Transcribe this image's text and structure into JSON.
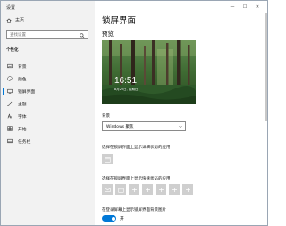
{
  "window": {
    "title": "设置"
  },
  "sidebar": {
    "home_label": "主页",
    "search_placeholder": "查找设置",
    "section_title": "个性化",
    "items": [
      {
        "label": "背景",
        "icon": "image-icon"
      },
      {
        "label": "颜色",
        "icon": "palette-icon"
      },
      {
        "label": "锁屏界面",
        "icon": "lock-screen-icon",
        "active": true
      },
      {
        "label": "主题",
        "icon": "brush-icon"
      },
      {
        "label": "字体",
        "icon": "font-icon"
      },
      {
        "label": "开始",
        "icon": "start-icon"
      },
      {
        "label": "任务栏",
        "icon": "taskbar-icon"
      }
    ]
  },
  "controls": {
    "minimize": "—",
    "maximize": "☐",
    "close": "✕"
  },
  "main": {
    "page_title": "锁屏界面",
    "preview_heading": "预览",
    "preview_time": "16:51",
    "preview_date": "8月22日, 星期日",
    "background_label": "背景",
    "background_value": "Windows 聚焦",
    "detail_status_label": "选择在锁屏界面上显示详细状态的应用",
    "quick_status_label": "选择在锁屏界面上显示快速状态的应用",
    "signin_bg_label": "在登录屏幕上显示锁屏界面背景图片",
    "signin_bg_toggle": "开"
  },
  "colors": {
    "accent": "#0078d7",
    "sidebar_bg": "#f2f2f2",
    "tile_bg": "#cfcfcf"
  }
}
